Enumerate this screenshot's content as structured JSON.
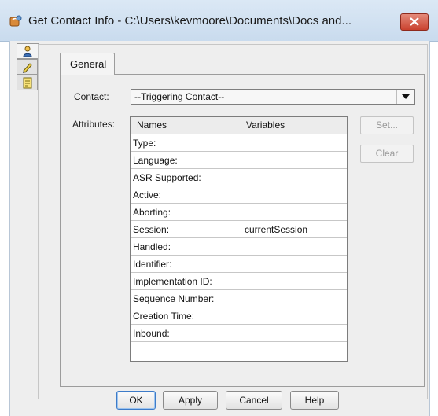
{
  "window": {
    "title": "Get Contact Info - C:\\Users\\kevmoore\\Documents\\Docs and...",
    "app_icon": "phone-script-icon",
    "close_icon": "close-icon"
  },
  "side_tabs": [
    {
      "icon": "person-icon"
    },
    {
      "icon": "pencil-icon"
    },
    {
      "icon": "note-icon"
    }
  ],
  "tabs": {
    "general": "General"
  },
  "form": {
    "contact_label": "Contact:",
    "contact_value": "--Triggering Contact--",
    "attributes_label": "Attributes:"
  },
  "table": {
    "headers": [
      "Names",
      "Variables"
    ],
    "rows": [
      {
        "name": "Type:",
        "variable": ""
      },
      {
        "name": "Language:",
        "variable": ""
      },
      {
        "name": "ASR Supported:",
        "variable": ""
      },
      {
        "name": "Active:",
        "variable": ""
      },
      {
        "name": "Aborting:",
        "variable": ""
      },
      {
        "name": "Session:",
        "variable": "currentSession"
      },
      {
        "name": "Handled:",
        "variable": ""
      },
      {
        "name": "Identifier:",
        "variable": ""
      },
      {
        "name": "Implementation ID:",
        "variable": ""
      },
      {
        "name": "Sequence Number:",
        "variable": ""
      },
      {
        "name": "Creation Time:",
        "variable": ""
      },
      {
        "name": "Inbound:",
        "variable": ""
      }
    ]
  },
  "buttons": {
    "set": "Set...",
    "clear": "Clear",
    "ok": "OK",
    "apply": "Apply",
    "cancel": "Cancel",
    "help": "Help"
  }
}
